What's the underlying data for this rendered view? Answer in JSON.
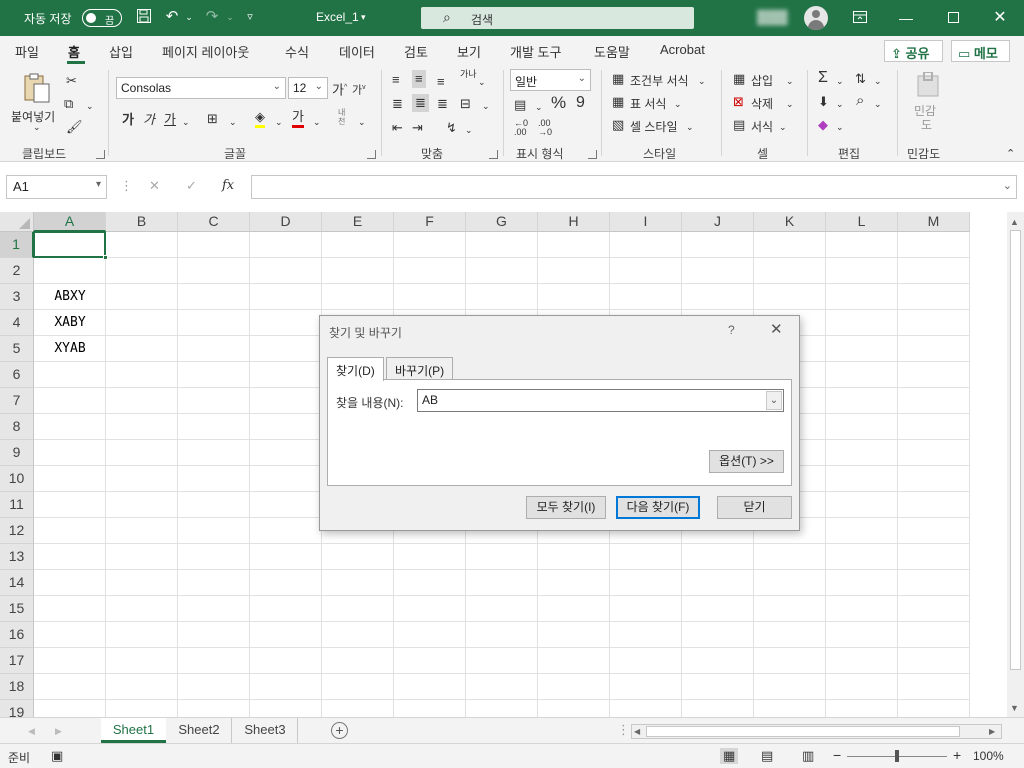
{
  "titlebar": {
    "autosave_label": "자동 저장",
    "autosave_state": "끔",
    "title": "Excel_1",
    "search_placeholder": "검색",
    "account_name": "▓▓▓"
  },
  "menu": {
    "items": [
      "파일",
      "홈",
      "삽입",
      "페이지 레이아웃",
      "수식",
      "데이터",
      "검토",
      "보기",
      "개발 도구",
      "도움말",
      "Acrobat"
    ],
    "active": "홈",
    "share_label": "공유",
    "comments_label": "메모"
  },
  "ribbon": {
    "clipboard": {
      "paste": "붙여넣기",
      "group": "클립보드"
    },
    "font": {
      "name": "Consolas",
      "size": "12",
      "group": "글꼴",
      "bold": "가",
      "italic": "가",
      "underline": "가",
      "fontcolor": "가",
      "phonetic": "내천"
    },
    "alignment": {
      "group": "맞춤",
      "wrap": "가나"
    },
    "number": {
      "format": "일반",
      "percent": "%",
      "comma": "9",
      "group": "표시 형식"
    },
    "styles": {
      "conditional": "조건부 서식",
      "table": "표 서식",
      "cell": "셀 스타일",
      "group": "스타일"
    },
    "cells": {
      "insert": "삽입",
      "delete": "삭제",
      "format": "서식",
      "group": "셀"
    },
    "editing": {
      "group": "편집"
    },
    "sensitivity": {
      "label1": "민감",
      "label2": "도",
      "group": "민감도"
    }
  },
  "formula": {
    "namebox": "A1",
    "fx": "fx",
    "value": ""
  },
  "grid": {
    "columns": [
      "A",
      "B",
      "C",
      "D",
      "E",
      "F",
      "G",
      "H",
      "I",
      "J",
      "K",
      "L",
      "M"
    ],
    "rows": [
      "1",
      "2",
      "3",
      "4",
      "5",
      "6",
      "7",
      "8",
      "9",
      "10",
      "11",
      "12",
      "13",
      "14",
      "15",
      "16",
      "17",
      "18",
      "19"
    ],
    "cells": {
      "A3": "ABXY",
      "A4": "XABY",
      "A5": "XYAB"
    }
  },
  "dialog": {
    "title": "찾기 및 바꾸기",
    "help": "?",
    "tab_find": "찾기(D)",
    "tab_replace": "바꾸기(P)",
    "find_label": "찾을 내용(N):",
    "find_value": "AB",
    "options_button": "옵션(T) >>",
    "find_all": "모두 찾기(I)",
    "find_next": "다음 찾기(F)",
    "close": "닫기"
  },
  "sheets": {
    "tabs": [
      "Sheet1",
      "Sheet2",
      "Sheet3"
    ],
    "active": "Sheet1",
    "add": "+"
  },
  "status": {
    "ready": "준비",
    "zoom": "100%",
    "zoom_minus": "−",
    "zoom_plus": "+"
  },
  "colors": {
    "accent": "#217346",
    "dialog_default_border": "#0078d7"
  }
}
